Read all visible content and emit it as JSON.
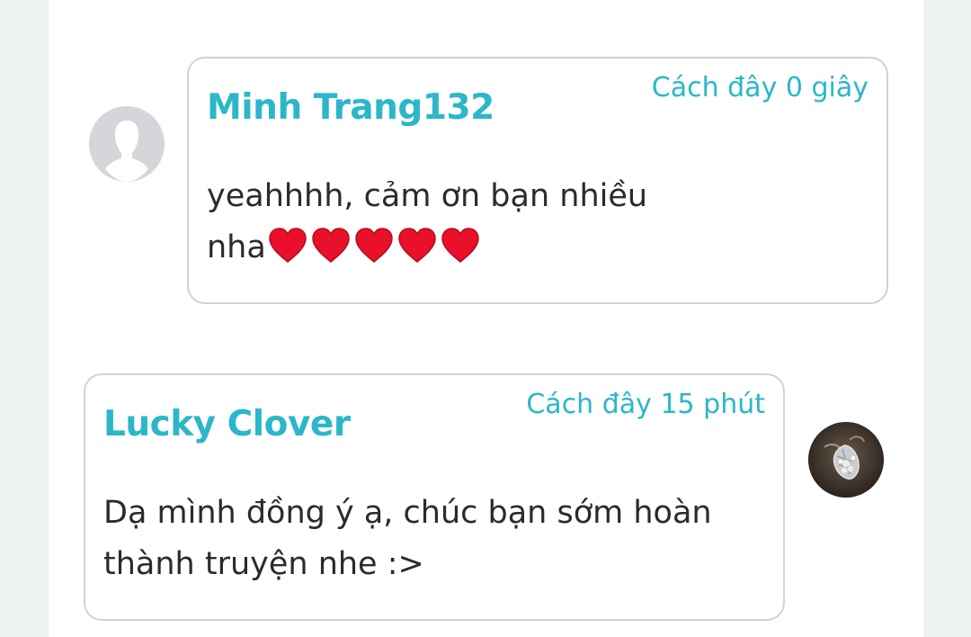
{
  "comments": [
    {
      "author": "Minh Trang132",
      "time": "Cách đây 0 giây",
      "text_line1": "yeahhhh, cảm ơn bạn nhiều",
      "text_line2": "nha",
      "hearts": [
        "heart",
        "heart",
        "heart",
        "heart",
        "heart"
      ],
      "avatar_icon": "default-user-icon",
      "side": "left"
    },
    {
      "author": "Lucky Clover",
      "time": "Cách đây 15 phút",
      "text_line1": "Dạ mình đồng ý ạ, chúc bạn sớm hoàn",
      "text_line2": "thành truyện nhe :>",
      "avatar_icon": "jewelry-photo-avatar",
      "side": "right"
    }
  ],
  "colors": {
    "accent": "#2bb7c9",
    "text": "#2b2b2b",
    "border": "#d2d2d2",
    "heart": "#e8102a",
    "page_bg": "#eef3f2"
  }
}
